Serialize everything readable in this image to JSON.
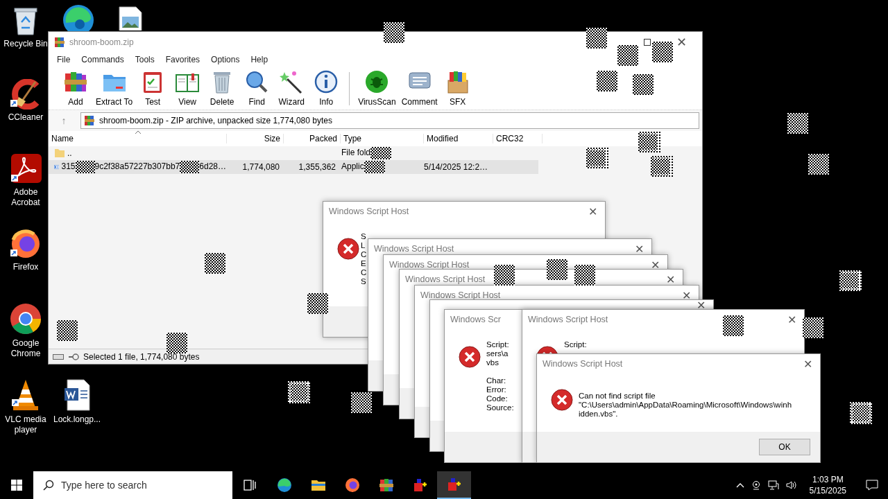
{
  "desktop_icons": [
    {
      "kind": "recycle",
      "label": "Recycle Bin"
    },
    {
      "kind": "edge"
    },
    {
      "kind": "image"
    },
    {
      "kind": "ccleaner",
      "label": "CCleaner"
    },
    {
      "kind": "acrobat",
      "label": "Adobe Acrobat"
    },
    {
      "kind": "firefox",
      "label": "Firefox"
    },
    {
      "kind": "chrome",
      "label": "Google Chrome"
    },
    {
      "kind": "vlc",
      "label": "VLC media player"
    },
    {
      "kind": "word",
      "label": "Lock.longp..."
    }
  ],
  "archive_window": {
    "title": "shroom-boom.zip",
    "close": "✕",
    "up": "↑",
    "menu": [
      "File",
      "Commands",
      "Tools",
      "Favorites",
      "Options",
      "Help"
    ],
    "toolbar": [
      {
        "kind": "add",
        "label": "Add"
      },
      {
        "kind": "extract",
        "label": "Extract To"
      },
      {
        "kind": "test",
        "label": "Test"
      },
      {
        "kind": "view",
        "label": "View"
      },
      {
        "kind": "delete",
        "label": "Delete"
      },
      {
        "kind": "find",
        "label": "Find"
      },
      {
        "kind": "wizard",
        "label": "Wizard"
      },
      {
        "kind": "info",
        "label": "Info"
      },
      {
        "kind": "scan",
        "label": "VirusScan"
      },
      {
        "kind": "comment",
        "label": "Comment"
      },
      {
        "kind": "sfx",
        "label": "SFX"
      }
    ],
    "address": "shroom-boom.zip - ZIP archive, unpacked size 1,774,080 bytes",
    "columns": [
      "Name",
      "Size",
      "Packed",
      "Type",
      "Modified",
      "CRC32"
    ],
    "rows": [
      {
        "kind": "folder",
        "name_parts": [
          ".."
        ],
        "type": "File fold",
        "selected": false
      },
      {
        "kind": "app",
        "name_parts": [
          "315",
          "9c2f38a57227b307bb7",
          "6d28…"
        ],
        "size": "1,774,080",
        "packed": "1,355,362",
        "type": "Applic",
        "modified": "5/14/2025 12:2…",
        "selected": true
      }
    ],
    "status": "Selected 1 file, 1,774,080 bytes"
  },
  "dialogs": [
    {
      "title": "Windows Script Host",
      "close": "✕",
      "kind": "error",
      "lines": [
        "S",
        "L",
        "C",
        "E",
        "C",
        "S"
      ]
    },
    {
      "title": "Windows Script Host",
      "close": "✕"
    },
    {
      "title": "Windows Script Host",
      "close": "✕"
    },
    {
      "title": "Windows Script Host",
      "close": "✕"
    },
    {
      "title": "Windows Script Host",
      "close": "✕"
    },
    {
      "close": "✕"
    },
    {
      "title": "Windows Scr",
      "kind": "error",
      "lines": [
        "Script:",
        "sers\\a",
        "vbs",
        "Char:",
        "Error:",
        "Code:",
        "Source:"
      ]
    },
    {
      "title": "Windows Script Host",
      "close": "✕",
      "kind": "error",
      "lines": [
        "Script:"
      ]
    },
    {
      "title": "Windows Script Host",
      "close": "✕",
      "kind": "error",
      "lines": [
        "Can not find script file",
        "\"C:\\Users\\admin\\AppData\\Roaming\\Microsoft\\Windows\\winh",
        "idden.vbs\"."
      ],
      "button": "OK"
    }
  ],
  "taskbar": {
    "search_placeholder": "Type here to search",
    "apps": [
      {
        "kind": "taskview",
        "selected": false
      },
      {
        "kind": "edge",
        "selected": false
      },
      {
        "kind": "explorer",
        "selected": false
      },
      {
        "kind": "firefox",
        "selected": false
      },
      {
        "kind": "winrar",
        "selected": false
      },
      {
        "kind": "script",
        "selected": false
      },
      {
        "kind": "script",
        "selected": true
      }
    ],
    "time": "1:03 PM",
    "date": "5/15/2025"
  }
}
